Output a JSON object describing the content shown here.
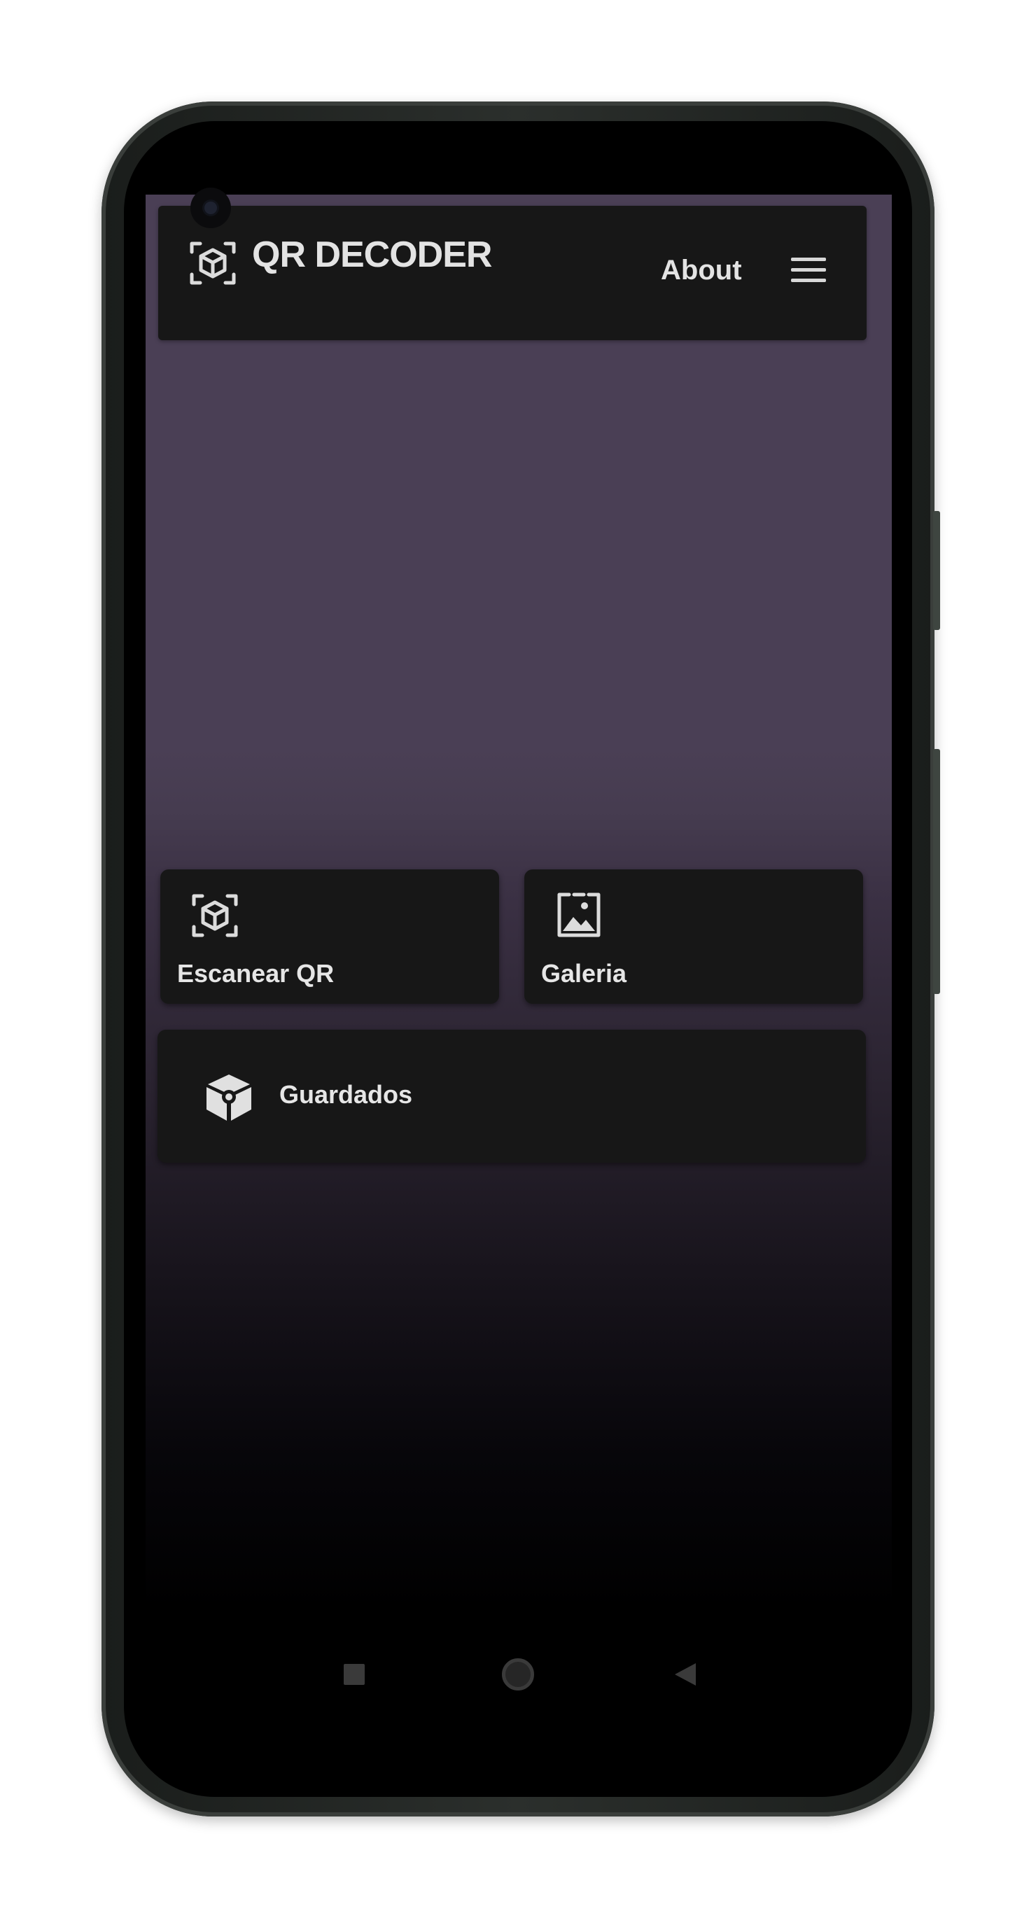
{
  "app": {
    "title": "QR DECODER",
    "about_label": "About",
    "logo_icon": "qr-scan-cube-icon",
    "menu_icon": "hamburger-menu-icon"
  },
  "actions": {
    "scan": {
      "label": "Escanear QR",
      "icon": "qr-scan-cube-icon"
    },
    "gallery": {
      "label": "Galeria",
      "icon": "image-gallery-icon"
    },
    "saved": {
      "label": "Guardados",
      "icon": "cube-box-icon"
    }
  },
  "navbar": {
    "recents_icon": "square-recents-icon",
    "home_icon": "circle-home-icon",
    "back_icon": "triangle-back-icon"
  },
  "colors": {
    "background_top": "#4a3f55",
    "background_bottom": "#000000",
    "surface": "#171717",
    "text": "#e3e3e3"
  }
}
